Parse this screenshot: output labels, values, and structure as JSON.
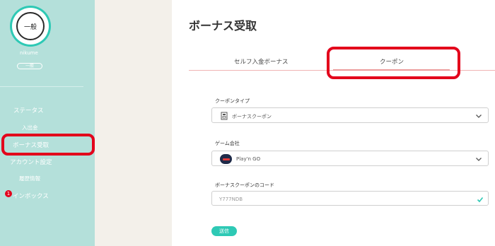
{
  "user": {
    "avatar_label": "一般",
    "username": "nikume",
    "rank_label": "一般"
  },
  "sidebar": {
    "items": [
      {
        "label": "ステータス"
      },
      {
        "label": "入出金"
      },
      {
        "label": "ボーナス受取"
      },
      {
        "label": "アカウント設定"
      },
      {
        "label": "履歴情報"
      },
      {
        "label": "インボックス",
        "badge": "1"
      }
    ]
  },
  "main": {
    "title": "ボーナス受取",
    "tabs": [
      {
        "label": "セルフ入金ボーナス"
      },
      {
        "label": "クーポン",
        "active": true
      }
    ]
  },
  "form": {
    "coupon_type": {
      "label": "クーポンタイプ",
      "value": "ボーナスクーポン",
      "icon": "coupon-icon"
    },
    "game_company": {
      "label": "ゲーム会社",
      "value": "Play'n GO",
      "icon": "playngo-logo"
    },
    "coupon_code": {
      "label": "ボーナスクーポンのコード",
      "value": "Y777NDB",
      "status_icon": "check-icon"
    },
    "submit_label": "送信"
  },
  "colors": {
    "sidebar_bg": "#b4e0da",
    "accent": "#2ec9b5",
    "highlight_red": "#e3001b"
  }
}
